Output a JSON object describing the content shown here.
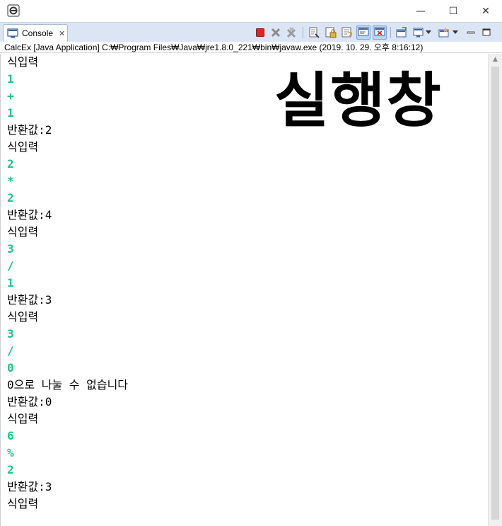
{
  "window": {
    "minimize_glyph": "—",
    "maximize_glyph": "☐",
    "close_glyph": "✕"
  },
  "tab": {
    "label": "Console",
    "close_glyph": "✕",
    "icon": "console-icon"
  },
  "toolbar": {
    "icons": [
      "terminate-icon",
      "remove-launch-icon",
      "remove-all-terminated-icon",
      "clear-console-icon",
      "scroll-lock-icon",
      "word-wrap-icon",
      "show-on-stdout-icon",
      "show-on-stderr-icon",
      "pin-console-icon",
      "display-console-icon",
      "open-console-icon",
      "minimize-icon",
      "maximize-icon"
    ]
  },
  "launch_info": "CalcEx [Java Application] C:₩Program Files₩Java₩jre1.8.0_221₩bin₩javaw.exe (2019. 10. 29. 오후 8:16:12)",
  "overlay_text": "실행창",
  "console_lines": [
    {
      "text": "식입력",
      "kind": "out"
    },
    {
      "text": "1",
      "kind": "in"
    },
    {
      "text": "+",
      "kind": "in"
    },
    {
      "text": "1",
      "kind": "in"
    },
    {
      "text": "반환값:2",
      "kind": "out"
    },
    {
      "text": "식입력",
      "kind": "out"
    },
    {
      "text": "2",
      "kind": "in"
    },
    {
      "text": "*",
      "kind": "in"
    },
    {
      "text": "2",
      "kind": "in"
    },
    {
      "text": "반환값:4",
      "kind": "out"
    },
    {
      "text": "식입력",
      "kind": "out"
    },
    {
      "text": "3",
      "kind": "in"
    },
    {
      "text": "/",
      "kind": "in"
    },
    {
      "text": "1",
      "kind": "in"
    },
    {
      "text": "반환값:3",
      "kind": "out"
    },
    {
      "text": "식입력",
      "kind": "out"
    },
    {
      "text": "3",
      "kind": "in"
    },
    {
      "text": "/",
      "kind": "in"
    },
    {
      "text": "0",
      "kind": "in"
    },
    {
      "text": "0으로 나눌 수 없습니다",
      "kind": "out"
    },
    {
      "text": "반환값:0",
      "kind": "out"
    },
    {
      "text": "식입력",
      "kind": "out"
    },
    {
      "text": "6",
      "kind": "in"
    },
    {
      "text": "%",
      "kind": "in"
    },
    {
      "text": "2",
      "kind": "in"
    },
    {
      "text": "반환값:3",
      "kind": "out"
    },
    {
      "text": "식입력",
      "kind": "out"
    }
  ],
  "colors": {
    "stdin": "#19c882",
    "stdout": "#000000",
    "tabbar_bg": "#dbe5f3",
    "terminate_red": "#d9262b"
  }
}
